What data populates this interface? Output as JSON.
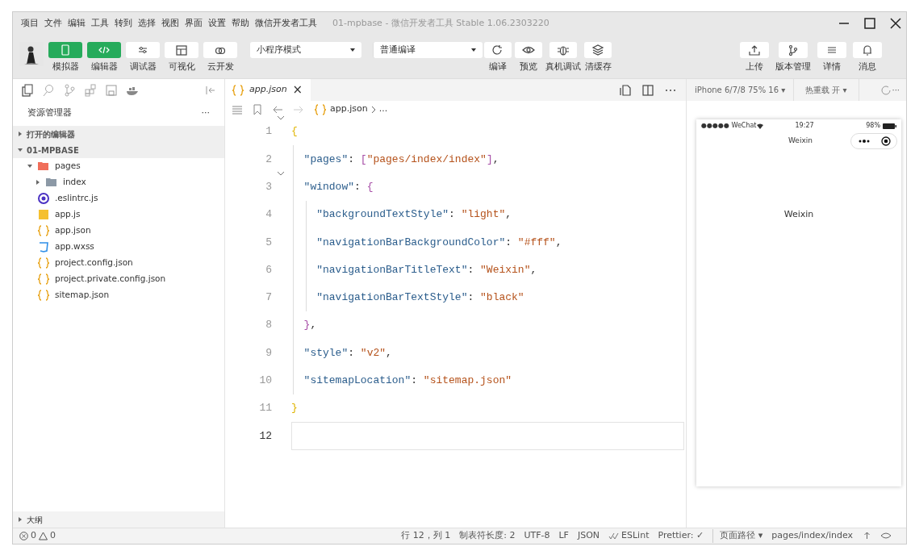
{
  "window": {
    "menu": [
      "项目",
      "文件",
      "编辑",
      "工具",
      "转到",
      "选择",
      "视图",
      "界面",
      "设置",
      "帮助",
      "微信开发者工具"
    ],
    "title": "01-mpbase - 微信开发者工具 Stable 1.06.2303220"
  },
  "toolbar": {
    "left_buttons": [
      {
        "label": "模拟器",
        "selected": true
      },
      {
        "label": "编辑器",
        "selected": true
      },
      {
        "label": "调试器",
        "selected": false
      },
      {
        "label": "可视化",
        "selected": false
      },
      {
        "label": "云开发",
        "selected": false
      }
    ],
    "mode_select": "小程序模式",
    "compile_select": "普通编译",
    "center_buttons": [
      {
        "label": "编译"
      },
      {
        "label": "预览"
      },
      {
        "label": "真机调试"
      },
      {
        "label": "清缓存"
      }
    ],
    "right_buttons": [
      {
        "label": "上传"
      },
      {
        "label": "版本管理"
      },
      {
        "label": "详情"
      },
      {
        "label": "消息"
      }
    ]
  },
  "sidebar": {
    "title": "资源管理器",
    "more": "···",
    "sections": [
      {
        "label": "打开的编辑器",
        "expanded": false
      },
      {
        "label": "01-MPBASE",
        "expanded": true,
        "children": [
          {
            "name": "pages",
            "kind": "folder-open",
            "expanded": true,
            "children": [
              {
                "name": "index",
                "kind": "folder",
                "expanded": false
              }
            ]
          },
          {
            "name": ".eslintrc.js",
            "kind": "eslint"
          },
          {
            "name": "app.js",
            "kind": "js"
          },
          {
            "name": "app.json",
            "kind": "json"
          },
          {
            "name": "app.wxss",
            "kind": "css"
          },
          {
            "name": "project.config.json",
            "kind": "json"
          },
          {
            "name": "project.private.config.json",
            "kind": "json"
          },
          {
            "name": "sitemap.json",
            "kind": "json"
          }
        ]
      }
    ],
    "outline": {
      "label": "大纲",
      "expanded": false
    }
  },
  "editor": {
    "tab": {
      "label": "app.json",
      "close": "×"
    },
    "breadcrumb": {
      "file": "app.json",
      "rest": "..."
    },
    "lines": [
      {
        "number": "1",
        "foldable": true,
        "current": false,
        "tokens": [
          {
            "kind": "bracket",
            "text": "{"
          }
        ]
      },
      {
        "number": "2",
        "foldable": false,
        "current": false,
        "tokens": [
          {
            "kind": "key",
            "text": "  \"pages\""
          },
          {
            "kind": "punct",
            "text": ": "
          },
          {
            "kind": "bracket2",
            "text": "["
          },
          {
            "kind": "string",
            "text": "\"pages/index/index\""
          },
          {
            "kind": "bracket2",
            "text": "]"
          },
          {
            "kind": "punct",
            "text": ","
          }
        ]
      },
      {
        "number": "3",
        "foldable": true,
        "current": false,
        "tokens": [
          {
            "kind": "key",
            "text": "  \"window\""
          },
          {
            "kind": "punct",
            "text": ": "
          },
          {
            "kind": "bracket2",
            "text": "{"
          }
        ]
      },
      {
        "number": "4",
        "foldable": false,
        "current": false,
        "tokens": [
          {
            "kind": "key",
            "text": "    \"backgroundTextStyle\""
          },
          {
            "kind": "punct",
            "text": ": "
          },
          {
            "kind": "string",
            "text": "\"light\""
          },
          {
            "kind": "punct",
            "text": ","
          }
        ]
      },
      {
        "number": "5",
        "foldable": false,
        "current": false,
        "tokens": [
          {
            "kind": "key",
            "text": "    \"navigationBarBackgroundColor\""
          },
          {
            "kind": "punct",
            "text": ": "
          },
          {
            "kind": "string",
            "text": "\"#fff\""
          },
          {
            "kind": "punct",
            "text": ","
          }
        ]
      },
      {
        "number": "6",
        "foldable": false,
        "current": false,
        "tokens": [
          {
            "kind": "key",
            "text": "    \"navigationBarTitleText\""
          },
          {
            "kind": "punct",
            "text": ": "
          },
          {
            "kind": "string",
            "text": "\"Weixin\""
          },
          {
            "kind": "punct",
            "text": ","
          }
        ]
      },
      {
        "number": "7",
        "foldable": false,
        "current": false,
        "tokens": [
          {
            "kind": "key",
            "text": "    \"navigationBarTextStyle\""
          },
          {
            "kind": "punct",
            "text": ": "
          },
          {
            "kind": "string",
            "text": "\"black\""
          }
        ]
      },
      {
        "number": "8",
        "foldable": false,
        "current": false,
        "tokens": [
          {
            "kind": "bracket2",
            "text": "  }"
          },
          {
            "kind": "punct",
            "text": ","
          }
        ]
      },
      {
        "number": "9",
        "foldable": false,
        "current": false,
        "tokens": [
          {
            "kind": "key",
            "text": "  \"style\""
          },
          {
            "kind": "punct",
            "text": ": "
          },
          {
            "kind": "string",
            "text": "\"v2\""
          },
          {
            "kind": "punct",
            "text": ","
          }
        ]
      },
      {
        "number": "10",
        "foldable": false,
        "current": false,
        "tokens": [
          {
            "kind": "key",
            "text": "  \"sitemapLocation\""
          },
          {
            "kind": "punct",
            "text": ": "
          },
          {
            "kind": "string",
            "text": "\"sitemap.json\""
          }
        ]
      },
      {
        "number": "11",
        "foldable": false,
        "current": false,
        "tokens": [
          {
            "kind": "bracket",
            "text": "}"
          }
        ]
      },
      {
        "number": "12",
        "foldable": false,
        "current": true
      }
    ]
  },
  "simulator": {
    "device_select": "iPhone 6/7/8 75% 16 ▾",
    "hot_reload": "热重载 开 ▾",
    "more": "···",
    "phone": {
      "carrier": "●●●●● WeChat",
      "time": "19:27",
      "battery": "98%",
      "nav_title": "Weixin",
      "body_text": "Weixin"
    }
  },
  "status_bar": {
    "errors": "0",
    "warnings": "0",
    "items": [
      "行 12，列 1",
      "制表符长度: 2",
      "UTF-8",
      "LF",
      "JSON",
      "ESLint",
      "Prettier: ✓",
      "页面路径 ▾",
      "pages/index/index"
    ]
  }
}
